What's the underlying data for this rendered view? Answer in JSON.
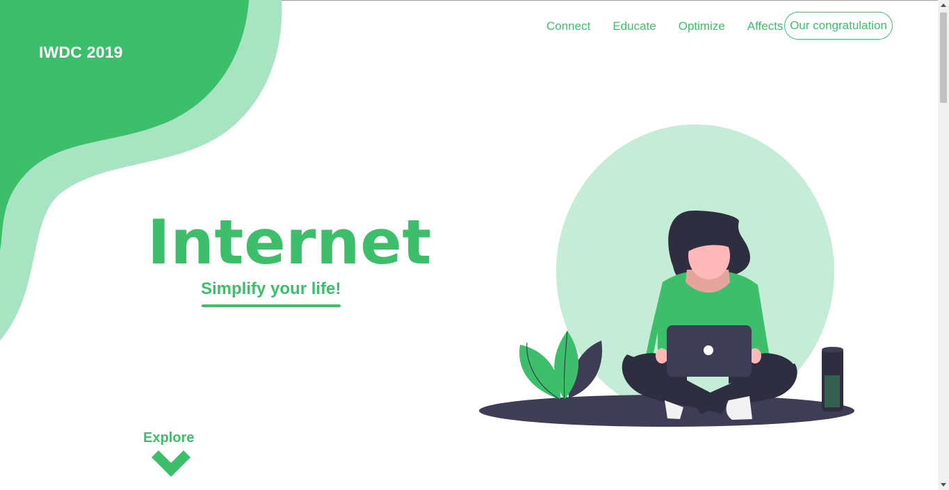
{
  "brand": "IWDC 2019",
  "nav": {
    "items": [
      "Connect",
      "Educate",
      "Optimize",
      "Affects"
    ],
    "cta": "Our congratulation"
  },
  "hero": {
    "title": "Internet",
    "tagline": "Simplify your life!",
    "explore": "Explore"
  },
  "colors": {
    "accent": "#3dbe6a",
    "accent_light": "#a9e4c2",
    "circle": "#c5ecd6",
    "dark": "#3f3d56",
    "hair": "#2f2e41",
    "skin": "#ffb8b8"
  },
  "icons": {
    "explore": "chevron-down-icon"
  }
}
